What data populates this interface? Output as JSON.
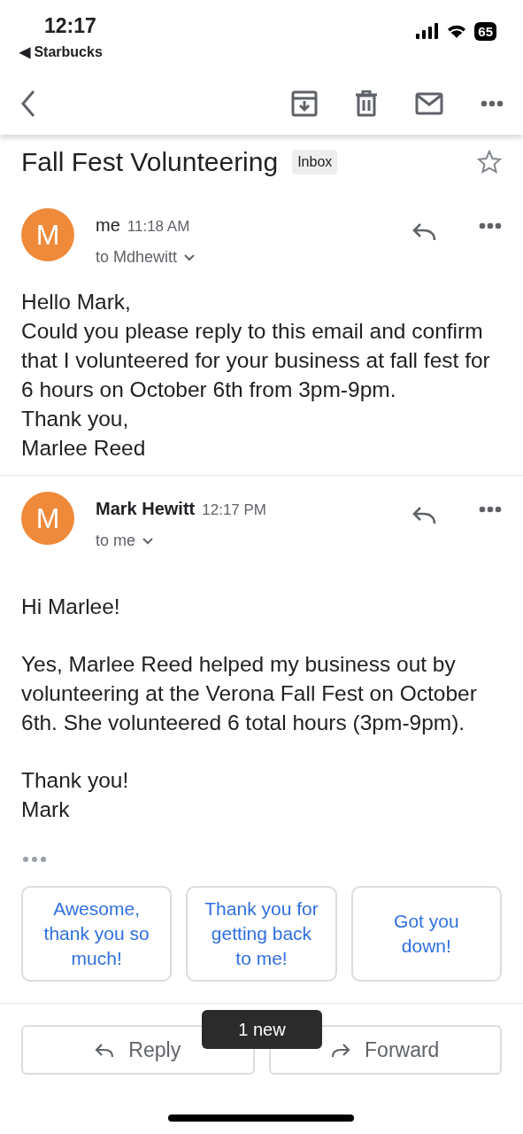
{
  "status_bar": {
    "time": "12:17",
    "back_app": "◀ Starbucks",
    "battery": "65"
  },
  "subject": {
    "title": "Fall Fest Volunteering",
    "label": "Inbox",
    "starred": false
  },
  "messages": [
    {
      "avatar": "M",
      "sender": "me",
      "time": "11:18 AM",
      "recipient": "to Mdhewitt",
      "bold_sender": false,
      "paragraphs": [
        "Hello Mark,\nCould you please reply to this email and confirm that I volunteered for your business at fall fest for 6 hours on October 6th from 3pm-9pm.\nThank you,\nMarlee Reed"
      ]
    },
    {
      "avatar": "M",
      "sender": "Mark Hewitt",
      "time": "12:17 PM",
      "recipient": "to me",
      "bold_sender": true,
      "paragraphs": [
        "Hi Marlee!",
        "Yes, Marlee Reed helped my business out by volunteering at the Verona Fall Fest on October 6th. She volunteered 6 total hours (3pm-9pm).",
        "Thank you!\nMark"
      ]
    }
  ],
  "smart_replies": [
    "Awesome, thank you so much!",
    "Thank you for getting back to me!",
    "Got you down!"
  ],
  "toast": "1 new",
  "actions": [
    "Reply",
    "Forward"
  ]
}
